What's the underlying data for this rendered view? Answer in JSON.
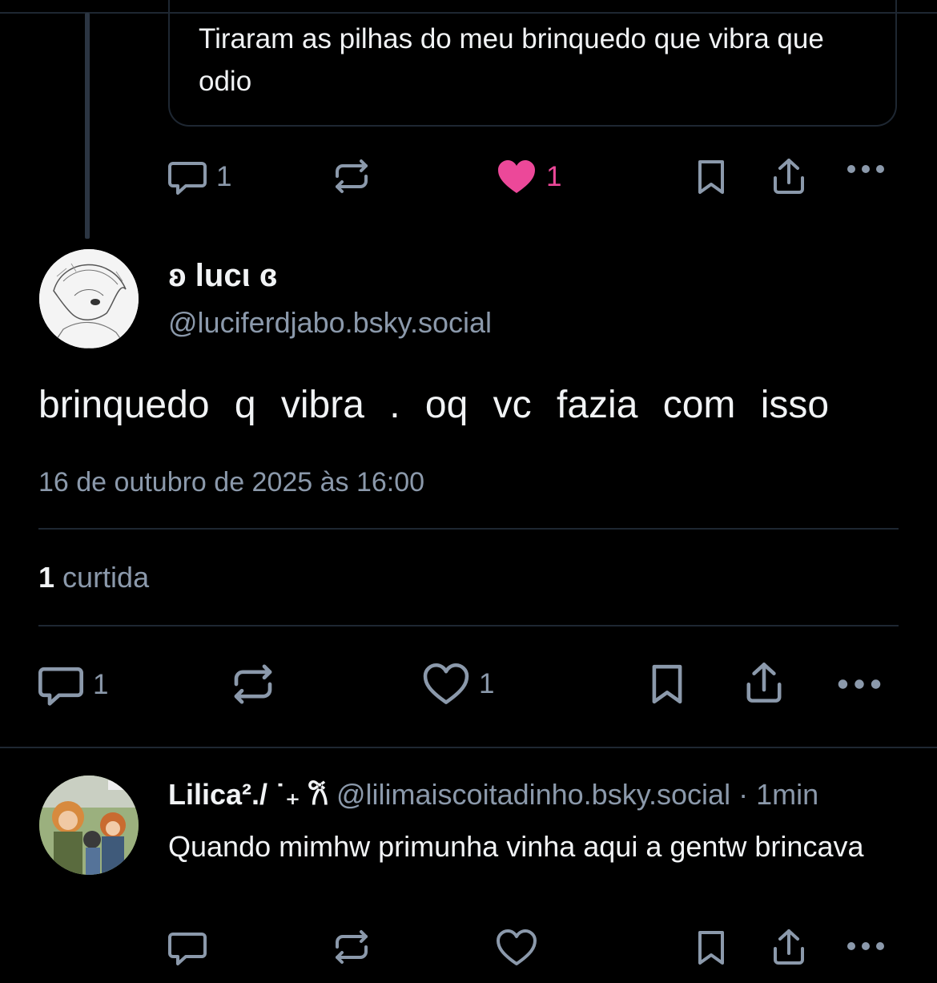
{
  "quoted_post": {
    "text": "Tiraram as pilhas do meu brinquedo que vibra que odio",
    "replies": "1",
    "likes": "1"
  },
  "main_post": {
    "display_name": "ʚ lucι ɞ",
    "handle": "@luciferdjabo.bsky.social",
    "text": "brinquedo q vibra . oq vc fazia com isso",
    "timestamp": "16 de outubro de 2025 às 16:00",
    "like_count": "1",
    "like_label": "curtida",
    "replies": "1",
    "likes": "1"
  },
  "reply_post": {
    "display_name": "Lilica²./ ˙₊ 𐙚",
    "handle": "@lilimaiscoitadinho.bsky.social",
    "separator": "·",
    "time_ago": "1min",
    "text": "Quando mimhw primunha vinha aqui a gentw brincava"
  },
  "colors": {
    "background": "#000000",
    "muted": "#8b99ab",
    "like_pink": "#ec4899",
    "border": "#1e2732"
  },
  "icons": [
    "comment-icon",
    "repost-icon",
    "heart-icon",
    "bookmark-icon",
    "share-icon",
    "more-icon"
  ]
}
